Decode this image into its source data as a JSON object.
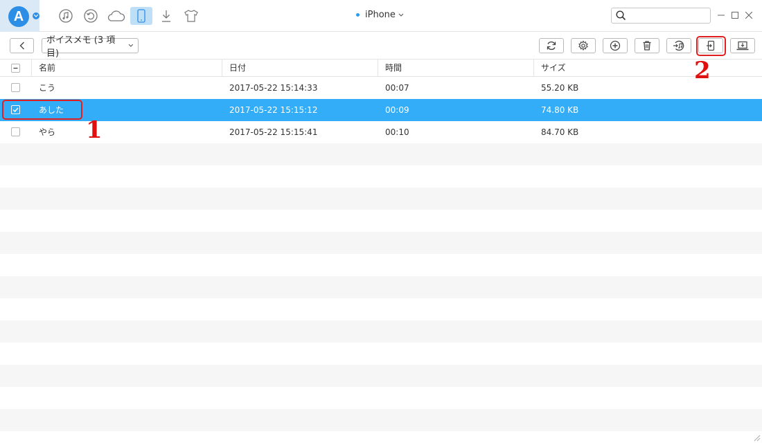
{
  "topbar": {
    "logo_letter": "A",
    "device_name": "iPhone",
    "search_placeholder": "",
    "nav_icons": [
      "music-icon",
      "history-icon",
      "cloud-icon",
      "phone-icon",
      "download-icon",
      "tshirt-icon"
    ],
    "active_nav": "phone-icon"
  },
  "toolbar": {
    "category_label": "ボイスメモ (3 項目)",
    "actions": [
      "refresh-icon",
      "settings-icon",
      "add-icon",
      "delete-icon",
      "to-itunes-icon",
      "export-to-device-icon",
      "export-to-pc-icon"
    ]
  },
  "table": {
    "headers": {
      "name": "名前",
      "date": "日付",
      "duration": "時間",
      "size": "サイズ"
    },
    "rows": [
      {
        "name": "こう",
        "date": "2017-05-22 15:14:33",
        "duration": "00:07",
        "size": "55.20 KB",
        "checked": false,
        "selected": false
      },
      {
        "name": "あした",
        "date": "2017-05-22 15:15:12",
        "duration": "00:09",
        "size": "74.80 KB",
        "checked": true,
        "selected": true
      },
      {
        "name": "やら",
        "date": "2017-05-22 15:15:41",
        "duration": "00:10",
        "size": "84.70 KB",
        "checked": false,
        "selected": false
      }
    ]
  },
  "annotations": {
    "step1": "1",
    "step2": "2"
  },
  "colors": {
    "accent": "#33adf8",
    "highlight": "#e02020",
    "brand": "#2d8ee6"
  }
}
